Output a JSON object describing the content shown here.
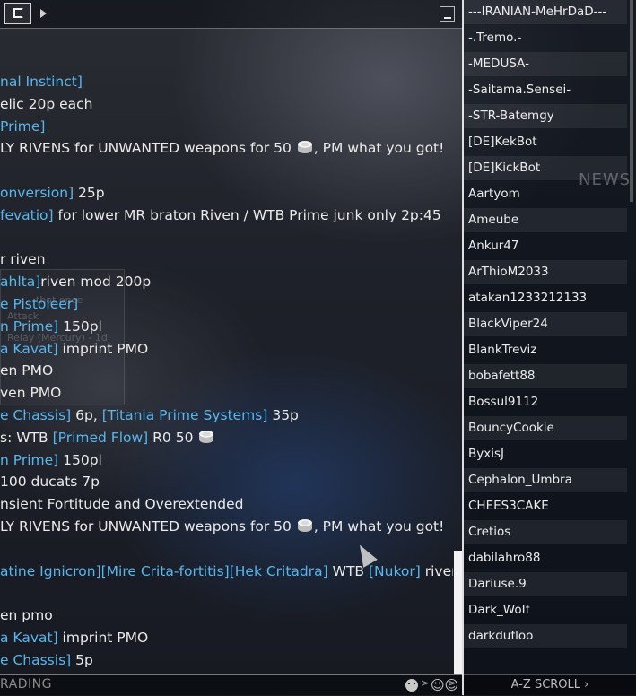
{
  "chat": {
    "channel_label": "RADING",
    "messages": [
      [
        {
          "t": "nal Instinct]",
          "c": "link"
        }
      ],
      [
        {
          "t": "elic 20p each"
        }
      ],
      [
        {
          "t": " Prime]",
          "c": "link"
        }
      ],
      [
        {
          "t": "LY RIVENS for UNWANTED weapons for 50 "
        },
        {
          "icon": "platinum-icon"
        },
        {
          "t": ", PM what you got!"
        }
      ],
      [],
      [
        {
          "t": "onversion]",
          "c": "link"
        },
        {
          "t": " 25p"
        }
      ],
      [
        {
          "t": "fevatio]",
          "c": "link"
        },
        {
          "t": " for lower MR braton Riven / WTB Prime junk only 2p:45"
        }
      ],
      [],
      [
        {
          "t": "r riven"
        }
      ],
      [
        {
          "t": "ahlta]",
          "c": "link"
        },
        {
          "t": "riven mod 200p"
        }
      ],
      [
        {
          "t": "e Pistoleer]",
          "c": "link"
        }
      ],
      [
        {
          "t": "n Prime]",
          "c": "link"
        },
        {
          "t": " 150pl"
        }
      ],
      [
        {
          "t": "a Kavat]",
          "c": "link"
        },
        {
          "t": " imprint PMO"
        }
      ],
      [
        {
          "t": "en PMO"
        }
      ],
      [
        {
          "t": "ven PMO"
        }
      ],
      [
        {
          "t": "e Chassis]",
          "c": "link"
        },
        {
          "t": " 6p,  "
        },
        {
          "t": "[Titania Prime Systems]",
          "c": "link"
        },
        {
          "t": " 35p"
        }
      ],
      [
        {
          "t": "s: WTB "
        },
        {
          "t": "[Primed Flow]",
          "c": "link"
        },
        {
          "t": " R0 50 "
        },
        {
          "icon": "platinum-icon"
        }
      ],
      [
        {
          "t": "n Prime]",
          "c": "link"
        },
        {
          "t": " 150pl"
        }
      ],
      [
        {
          "t": " 100 ducats 7p"
        }
      ],
      [
        {
          "t": "nsient Fortitude and Overextended"
        }
      ],
      [
        {
          "t": "LY RIVENS for UNWANTED weapons for 50 "
        },
        {
          "icon": "platinum-icon"
        },
        {
          "t": ", PM what you got!"
        }
      ],
      [],
      [
        {
          "t": "atine Ignicron][Mire Crita-fortitis][Hek Critadra]",
          "c": "link"
        },
        {
          "t": " WTB "
        },
        {
          "t": "[Nukor]",
          "c": "link"
        },
        {
          "t": " riven"
        }
      ],
      [],
      [
        {
          "t": "en pmo"
        }
      ],
      [
        {
          "t": "a Kavat]",
          "c": "link"
        },
        {
          "t": " imprint PMO"
        }
      ],
      [
        {
          "t": "e Chassis]",
          "c": "link"
        },
        {
          "t": " 5p"
        }
      ]
    ]
  },
  "background": {
    "ghost_texts": [
      "that once",
      "Attack",
      "Relay (Mercury) - 1d"
    ]
  },
  "userlist": {
    "news_label": "NEWS",
    "users": [
      "---IRANIAN-MeHrDaD---",
      "-.Tremo.-",
      "-MEDUSA-",
      "-Saitama.Sensei-",
      "-STR-Batemgy",
      "[DE]KekBot",
      "[DE]KickBot",
      "Aartyom",
      "Ameube",
      "Ankur47",
      "ArThioM2033",
      "atakan1233212133",
      "BlackViper24",
      "BlankTreviz",
      "bobafett88",
      "Bossul9112",
      "BouncyCookie",
      "ByxisJ",
      "Cephalon_Umbra",
      "CHEES3CAKE",
      "Cretios",
      "dabilahro88",
      "Dariuse.9",
      "Dark_WoIf",
      "darkdufloo"
    ],
    "footer": "A-Z SCROLL"
  },
  "icons": {
    "arrow": "▶",
    "players": "☺☺"
  },
  "colors": {
    "link": "#56b6ee",
    "text": "#eaeaea"
  }
}
